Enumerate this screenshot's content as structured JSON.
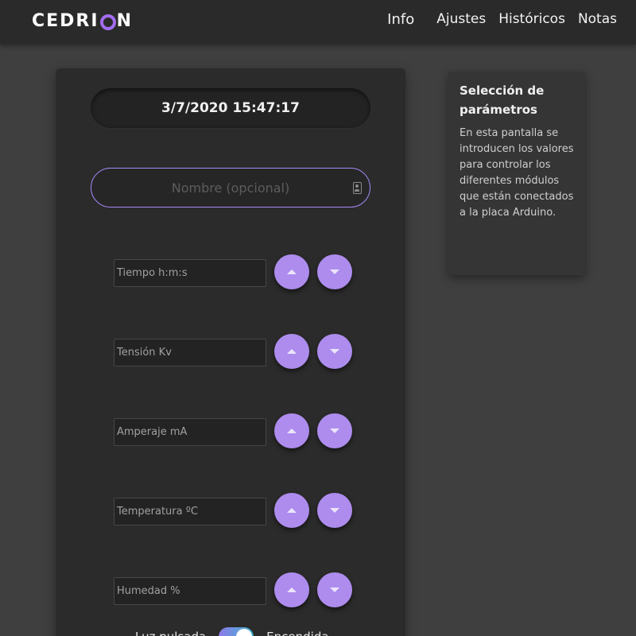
{
  "header": {
    "logo_pre": "CEDRI",
    "logo_post": "N",
    "nav": [
      "Info",
      "Ajustes",
      "Históricos",
      "Notas"
    ]
  },
  "main": {
    "datetime": "3/7/2020 15:47:17",
    "name_placeholder": "Nombre (opcional)",
    "params": [
      {
        "placeholder": "Tiempo h:m:s"
      },
      {
        "placeholder": "Tensión Kv"
      },
      {
        "placeholder": "Amperaje mA"
      },
      {
        "placeholder": "Temperatura ºC"
      },
      {
        "placeholder": "Humedad %"
      }
    ],
    "toggle": {
      "left_label": "Luz pulsada",
      "right_label": "Encendida",
      "on": true
    }
  },
  "info": {
    "title": "Selección de parámetros",
    "body": "En esta pantalla se introducen los valores para controlar los diferentes módulos que están conectados a la placa Arduino."
  },
  "colors": {
    "accent": "#ad8cee",
    "field_border": "#a78bfa",
    "background": "#3f3f3f",
    "panel": "#2b2b2b"
  },
  "icons": [
    "up-arrow-icon",
    "down-arrow-icon",
    "contact-card-icon",
    "logo-ring-icon"
  ]
}
